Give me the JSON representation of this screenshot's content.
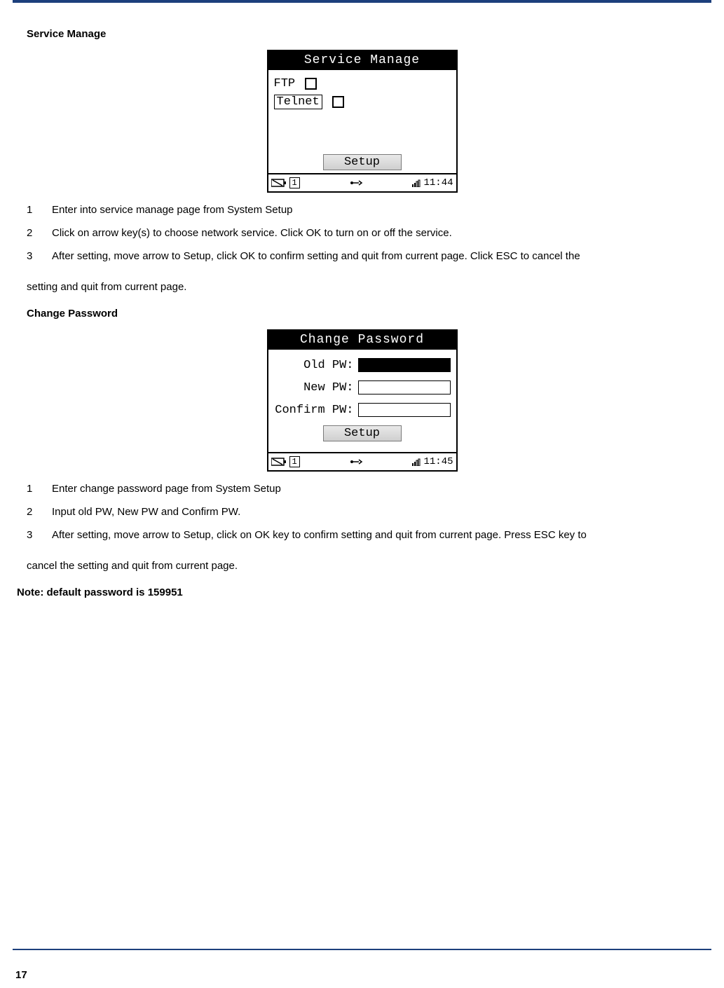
{
  "page_number": "17",
  "section1": {
    "heading": "Service Manage",
    "lcd": {
      "title": "Service Manage",
      "items": [
        {
          "label": "FTP",
          "checked": false,
          "selected": false
        },
        {
          "label": "Telnet",
          "checked": false,
          "selected": true
        }
      ],
      "setup_button": "Setup",
      "status": {
        "battery_index": "1",
        "time": "11:44"
      }
    },
    "steps": [
      {
        "n": "1",
        "t": "Enter into service manage page from System Setup"
      },
      {
        "n": "2",
        "t": "Click on arrow key(s) to choose network service. Click OK to turn on or off the service."
      },
      {
        "n": "3",
        "t": "After setting, move arrow to Setup, click OK to confirm setting and quit from current page. Click ESC to cancel the"
      }
    ],
    "trail": "setting and quit from current page."
  },
  "section2": {
    "heading": "Change Password",
    "lcd": {
      "title": "Change Password",
      "fields": [
        {
          "label": "Old PW:",
          "filled": true
        },
        {
          "label": "New PW:",
          "filled": false
        },
        {
          "label": "Confirm PW:",
          "filled": false
        }
      ],
      "setup_button": "Setup",
      "status": {
        "battery_index": "1",
        "time": "11:45"
      }
    },
    "steps": [
      {
        "n": "1",
        "t": "Enter change password page from System Setup"
      },
      {
        "n": "2",
        "t": "Input old PW, New PW and Confirm PW."
      },
      {
        "n": "3",
        "t": "After setting, move arrow to Setup, click on OK key to confirm setting and quit from current page. Press ESC key to"
      }
    ],
    "trail": "cancel the setting and quit from current page."
  },
  "note": "Note: default password is 159951"
}
